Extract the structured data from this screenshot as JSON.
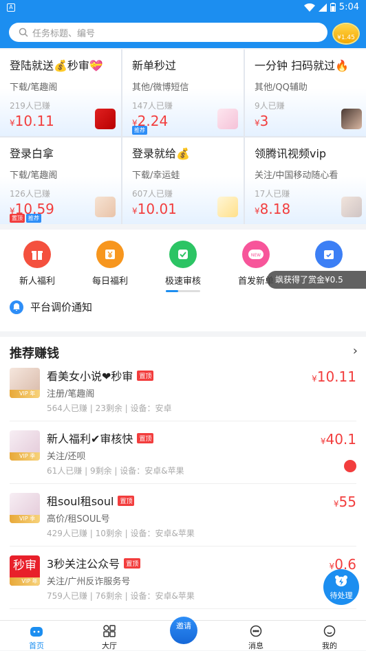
{
  "status": {
    "app_icon": "A",
    "time": "5:04"
  },
  "search": {
    "placeholder": "任务标题、编号",
    "coin": "¥1.45"
  },
  "grid": [
    {
      "title": "登陆就送💰秒审💝",
      "sub": "下载/笔趣阁",
      "count": "219人已赚",
      "price": "10.11",
      "thumb": "red-book",
      "tags": []
    },
    {
      "title": "新单秒过",
      "sub": "其他/微博短信",
      "count": "147人已赚",
      "price": "2.24",
      "thumb": "anime",
      "tags": [
        {
          "t": "推荐",
          "c": "blue"
        }
      ]
    },
    {
      "title": "一分钟 扫码就过🔥",
      "sub": "其他/QQ辅助",
      "count": "9人已赚",
      "price": "3",
      "thumb": "girl",
      "tags": []
    },
    {
      "title": "登录白拿",
      "sub": "下载/笔趣阁",
      "count": "126人已赚",
      "price": "10.59",
      "thumb": "baby",
      "tags": [
        {
          "t": "置顶",
          "c": "red"
        },
        {
          "t": "推荐",
          "c": "blue"
        }
      ]
    },
    {
      "title": "登录就给💰",
      "sub": "下载/幸运蛙",
      "count": "607人已赚",
      "price": "10.01",
      "thumb": "simple",
      "tags": []
    },
    {
      "title": "领腾讯视频vip",
      "sub": "关注/中国移动随心看",
      "count": "17人已赚",
      "price": "8.18",
      "thumb": "baby2",
      "tags": []
    }
  ],
  "quick": [
    {
      "label": "新人福利",
      "color": "#f4503e",
      "icon": "gift-icon"
    },
    {
      "label": "每日福利",
      "color": "#f7961e",
      "icon": "yen-icon"
    },
    {
      "label": "极速审核",
      "color": "#2cc464",
      "icon": "check-icon"
    },
    {
      "label": "首发新单",
      "color": "#f7559a",
      "icon": "new-icon"
    },
    {
      "label": "",
      "color": "#3c7ff5",
      "icon": "calendar-icon"
    }
  ],
  "toast": "飒获得了赏金¥0.5",
  "notice": "平台调价通知",
  "recommend": {
    "title": "推荐赚钱",
    "items": [
      {
        "title": "看美女小说❤秒审",
        "tag": "置顶",
        "sub": "注册/笔趣阁",
        "meta": "564人已赚 | 23剩余 | 设备：安卓",
        "price": "10.11",
        "vip": "年"
      },
      {
        "title": "新人福利✔审核快",
        "tag": "置顶",
        "sub": "关注/还呗",
        "meta": "61人已赚 | 9剩余 | 设备：安卓&苹果",
        "price": "40.1",
        "vip": "季"
      },
      {
        "title": "租soul租soul",
        "tag": "置顶",
        "sub": "高价/租SOUL号",
        "meta": "429人已赚 | 10剩余 | 设备：安卓&苹果",
        "price": "55",
        "vip": "季"
      },
      {
        "title": "3秒关注公众号",
        "tag": "置顶",
        "sub": "关注/广州反诈服务号",
        "meta": "759人已赚 | 76剩余 | 设备：安卓&苹果",
        "price": "0.6",
        "vip": "年"
      }
    ]
  },
  "fab": "待处理",
  "tabs": [
    {
      "label": "首页"
    },
    {
      "label": "大厅"
    },
    {
      "label": "邀请"
    },
    {
      "label": "消息"
    },
    {
      "label": "我的"
    }
  ]
}
